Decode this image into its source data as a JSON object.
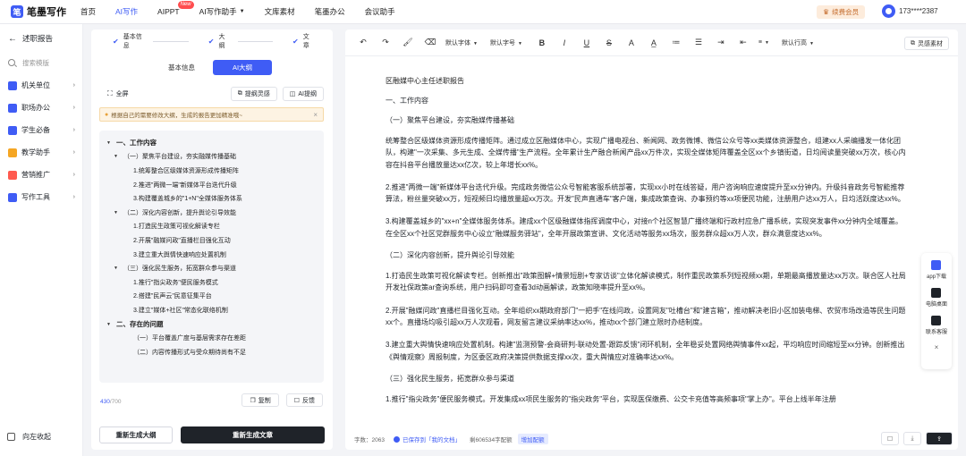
{
  "app": {
    "logo_mark": "笔",
    "name": "笔墨写作"
  },
  "topnav": [
    {
      "label": "首页",
      "active": false
    },
    {
      "label": "AI写作",
      "active": true
    },
    {
      "label": "AIPPT",
      "active": false,
      "badge": "New"
    },
    {
      "label": "AI写作助手",
      "active": false,
      "dropdown": true
    },
    {
      "label": "文库素材",
      "active": false
    },
    {
      "label": "笔墨办公",
      "active": false
    },
    {
      "label": "会议助手",
      "active": false
    }
  ],
  "vip": {
    "label": "续费会员"
  },
  "user": {
    "phone": "173****2387"
  },
  "sidebar": {
    "back_label": "述职报告",
    "search_placeholder": "搜索模版",
    "items": [
      {
        "label": "机关单位",
        "color": "#3f5cf5"
      },
      {
        "label": "职场办公",
        "color": "#3f5cf5"
      },
      {
        "label": "学生必备",
        "color": "#3f5cf5"
      },
      {
        "label": "教学助手",
        "color": "#f5a623"
      },
      {
        "label": "营销推广",
        "color": "#ff5a4f"
      },
      {
        "label": "写作工具",
        "color": "#3f5cf5"
      }
    ],
    "collapse_label": "向左收起"
  },
  "left": {
    "steps": [
      "基本信息",
      "大纲",
      "文章"
    ],
    "tabs": [
      "基本信息",
      "AI大纲"
    ],
    "fullscreen": "全屏",
    "tool_insp": "提纲灵感",
    "tool_ai": "AI提纲",
    "tip": "根据自己的需要修改大纲，生成的报告更加精准哦~",
    "outline": [
      {
        "level": 1,
        "text": "一、工作内容",
        "toggle": true
      },
      {
        "level": 2,
        "text": "（一）聚焦平台建设，夯实融媒传播基础",
        "toggle": true
      },
      {
        "level": 3,
        "text": "1.统筹整合区级媒体资源形成传播矩阵"
      },
      {
        "level": 3,
        "text": "2.推进\"两微一端\"新媒体平台迭代升级"
      },
      {
        "level": 3,
        "text": "3.构建覆盖城乡的\"1+N\"全媒体服务体系"
      },
      {
        "level": 2,
        "text": "（二）深化内容创新，提升舆论引导效能",
        "toggle": true
      },
      {
        "level": 3,
        "text": "1.打造民生政策可视化解读专栏"
      },
      {
        "level": 3,
        "text": "2.开展\"融媒问政\"直播栏目强化互动"
      },
      {
        "level": 3,
        "text": "3.建立重大舆情快速响应处置机制"
      },
      {
        "level": 2,
        "text": "（三）强化民生服务，拓宽群众参与渠道",
        "toggle": true
      },
      {
        "level": 3,
        "text": "1.推行\"指尖政务\"便民服务模式"
      },
      {
        "level": 3,
        "text": "2.搭建\"民声云\"民意征集平台"
      },
      {
        "level": 3,
        "text": "3.建立\"媒体+社区\"常态化联络机制"
      },
      {
        "level": 1,
        "text": "二、存在的问题",
        "toggle": true
      },
      {
        "level": 3,
        "text": "（一）平台覆盖广度与基层需求存在差距"
      },
      {
        "level": 3,
        "text": "（二）内容传播形式与受众期待尚有不足"
      }
    ],
    "counter": "430",
    "counter_max": "/700",
    "copy": "复制",
    "feedback": "反馈",
    "regen_outline": "重新生成大纲",
    "regen_article": "重新生成文章"
  },
  "toolbar": {
    "font": "默认字体",
    "size": "默认字号",
    "line": "默认行高",
    "inspire": "灵感素材"
  },
  "doc": {
    "title": "区融媒中心主任述职报告",
    "h1": "一、工作内容",
    "sec1": "（一）聚焦平台建设，夯实融媒传播基础",
    "p1": "统筹整合区级媒体资源形成传播矩阵。通过成立区融媒体中心，实现广播电视台、新闻网、政务微博、微信公众号等xx类媒体资源整合，组建xx人采编播发一体化团队，构建\"一次采集、多元生成、全媒传播\"生产流程。全年累计生产融合新闻产品xx万件次，实现全媒体矩阵覆盖全区xx个乡镇街道，日均阅读量突破xx万次，核心内容在抖音平台播放量达xx亿次，较上年增长xx%。",
    "p2": "2.推进\"两微一端\"新媒体平台迭代升级。完成政务微信公众号智能客服系统部署，实现xx小时在线答疑，用户咨询响应速度提升至xx分钟内。升级抖音政务号智能推荐算法，粉丝量突破xx万，短视频日均播放量超xx万次。开发\"民声直通车\"客户端，集成政策查询、办事预约等xx项便民功能，注册用户达xx万人，日均活跃度达xx%。",
    "p3": "3.构建覆盖城乡的\"xx+n\"全媒体服务体系。建成xx个区级融媒体指挥调度中心，对接n个社区智慧广播终端和行政村应急广播系统，实现突发事件xx分钟内全域覆盖。在全区xx个社区党群服务中心设立\"融媒服务驿站\"，全年开展政策宣讲、文化活动等服务xx场次，服务群众超xx万人次，群众满意度达xx%。",
    "sec2": "（二）深化内容创新，提升舆论引导效能",
    "p4": "1.打造民生政策可视化解读专栏。创新推出\"政策图解+情景短剧+专家访谈\"立体化解读模式，制作重民政策系列短视频xx期，单期最高播放量达xx万次。联合区人社局开发社保政策ar查询系统，用户扫码即可查看3d动画解读，政策知晓率提升至xx%。",
    "p5": "2.开展\"融媒问政\"直播栏目强化互动。全年组织xx期政府部门\"一把手\"在线问政，设置网友\"吐槽台\"和\"建言箱\"，推动解决老旧小区加装电梯、农贸市场改造等民生问题xx个。直播场均吸引超xx万人次观看，网友留言建议采纳率达xx%，推动xx个部门建立限时办结制度。",
    "p6": "3.建立重大舆情快速响应处置机制。构建\"监测预警-会商研判-联动处置-跟踪反馈\"闭环机制，全年稳妥处置网络舆情事件xx起，平均响应时间缩短至xx分钟。创新推出《舆情观察》周报制度，为区委区政府决策提供数据支撑xx次，重大舆情应对准确率达xx%。",
    "sec3": "（三）强化民生服务，拓宽群众参与渠道",
    "p7": "1.推行\"指尖政务\"便民服务模式。开发集成xx项民生服务的\"指尖政务\"平台，实现医保缴费、公交卡充值等高频事项\"掌上办\"。平台上线半年注册"
  },
  "status": {
    "wordcount": "字数：2063",
    "saved": "已保存到「我的文档」",
    "deduct": "剩606534字配额",
    "add": "增加配额"
  },
  "float": [
    {
      "label": "app下载",
      "color": "#3f5cf5"
    },
    {
      "label": "电脑桌面",
      "color": "#1f2329"
    },
    {
      "label": "联系客服",
      "color": "#1f2329"
    }
  ]
}
